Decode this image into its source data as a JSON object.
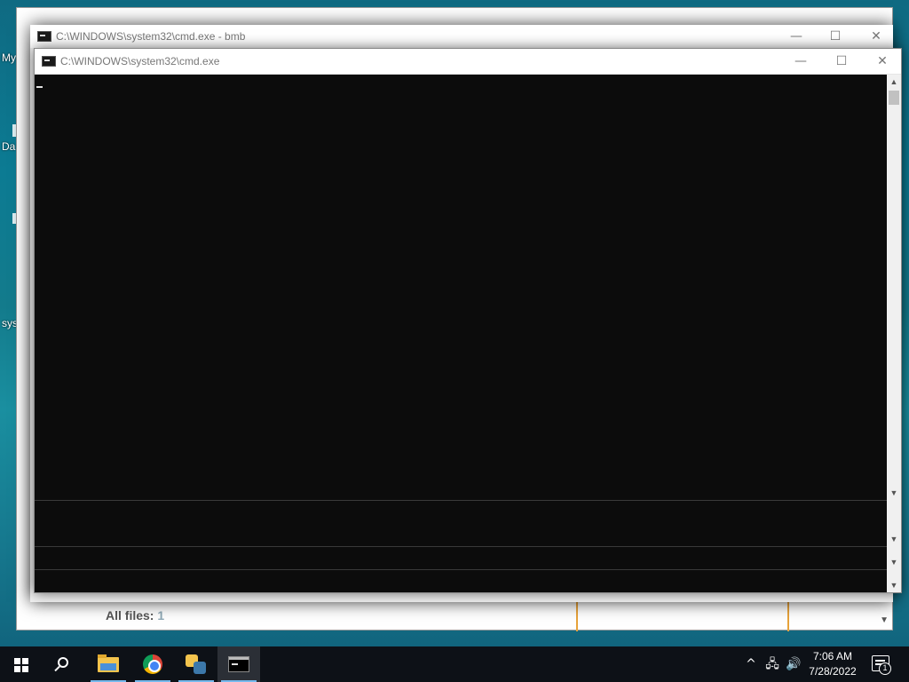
{
  "desktop": {
    "icon_labels": [
      "My",
      "Da",
      "sys"
    ]
  },
  "background_app": {
    "all_files_label": "All files:",
    "all_files_count": "1"
  },
  "cmd_back": {
    "title": "C:\\WINDOWS\\system32\\cmd.exe - bmb",
    "minimize": "—",
    "maximize": "☐",
    "close": "✕"
  },
  "cmd_front": {
    "title": "C:\\WINDOWS\\system32\\cmd.exe",
    "minimize": "—",
    "maximize": "☐",
    "close": "✕",
    "scroll_up": "▲",
    "scroll_down": "▼"
  },
  "taskbar": {
    "icons": [
      "windows-start",
      "search",
      "file-explorer",
      "chrome",
      "python",
      "cmd"
    ],
    "tray_chevron": "^",
    "network_glyph": "🖧",
    "volume_glyph": "🔊",
    "time": "7:06 AM",
    "date": "7/28/2022",
    "notification_count": "1"
  }
}
